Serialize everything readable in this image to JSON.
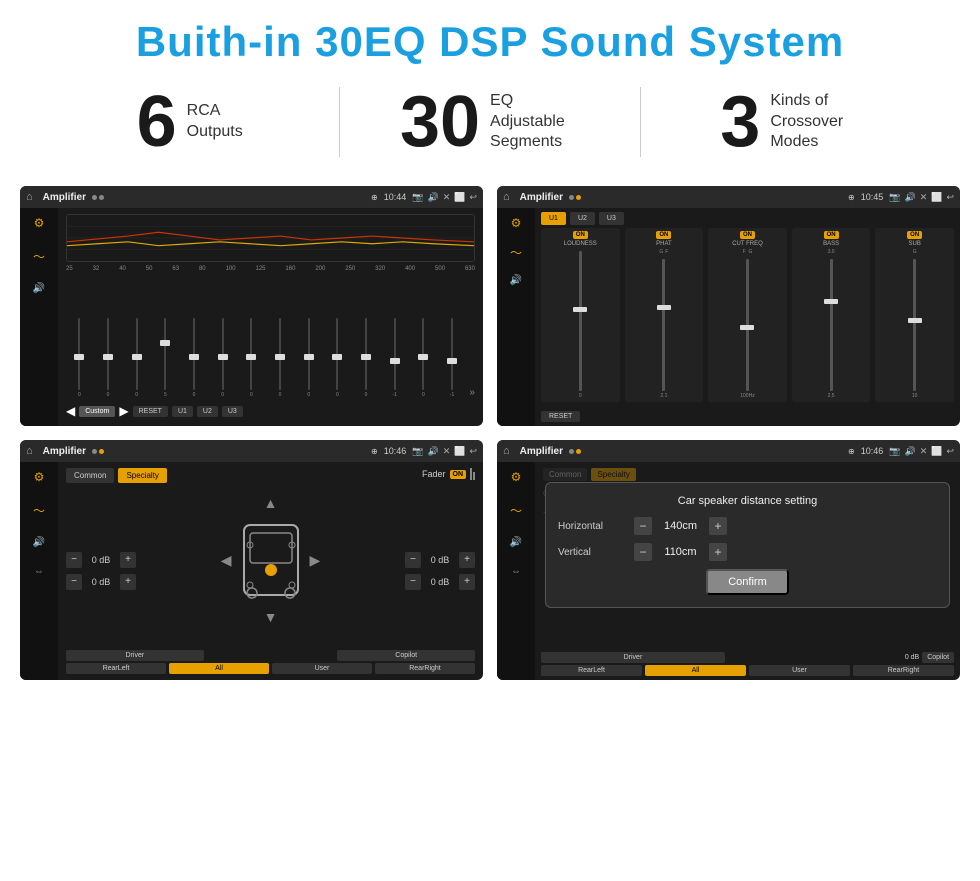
{
  "page": {
    "title": "Buith-in 30EQ DSP Sound System"
  },
  "stats": [
    {
      "number": "6",
      "label": "RCA\nOutputs"
    },
    {
      "number": "30",
      "label": "EQ Adjustable\nSegments"
    },
    {
      "number": "3",
      "label": "Kinds of\nCrossover Modes"
    }
  ],
  "screen1": {
    "topbar": {
      "app": "Amplifier",
      "time": "10:44"
    },
    "freq_labels": [
      "25",
      "32",
      "40",
      "50",
      "63",
      "80",
      "100",
      "125",
      "160",
      "200",
      "250",
      "320",
      "400",
      "500",
      "630"
    ],
    "slider_values": [
      "0",
      "0",
      "0",
      "5",
      "0",
      "0",
      "0",
      "0",
      "0",
      "0",
      "0",
      "-1",
      "0",
      "-1"
    ],
    "controls": [
      "Custom",
      "RESET",
      "U1",
      "U2",
      "U3"
    ]
  },
  "screen2": {
    "topbar": {
      "app": "Amplifier",
      "time": "10:45"
    },
    "presets": [
      "U1",
      "U2",
      "U3"
    ],
    "bands": [
      {
        "name": "LOUDNESS",
        "on": true
      },
      {
        "name": "PHAT",
        "on": true
      },
      {
        "name": "CUT FREQ",
        "on": true
      },
      {
        "name": "BASS",
        "on": true
      },
      {
        "name": "SUB",
        "on": true
      }
    ],
    "reset_label": "RESET"
  },
  "screen3": {
    "topbar": {
      "app": "Amplifier",
      "time": "10:46"
    },
    "tabs": [
      "Common",
      "Specialty"
    ],
    "fader_label": "Fader",
    "fader_on": "ON",
    "db_values": [
      "0 dB",
      "0 dB",
      "0 dB",
      "0 dB"
    ],
    "bottom_btns": [
      "Driver",
      "",
      "Copilot",
      "RearLeft",
      "All",
      "User",
      "RearRight"
    ]
  },
  "screen4": {
    "topbar": {
      "app": "Amplifier",
      "time": "10:46"
    },
    "tabs": [
      "Common",
      "Specialty"
    ],
    "dialog": {
      "title": "Car speaker distance setting",
      "horizontal_label": "Horizontal",
      "horizontal_value": "140cm",
      "vertical_label": "Vertical",
      "vertical_value": "110cm",
      "confirm_label": "Confirm",
      "db_values": [
        "0 dB",
        "0 dB"
      ]
    },
    "bottom_btns": [
      "Driver",
      "Copilot",
      "RearLeft",
      "User",
      "RearRight"
    ]
  }
}
